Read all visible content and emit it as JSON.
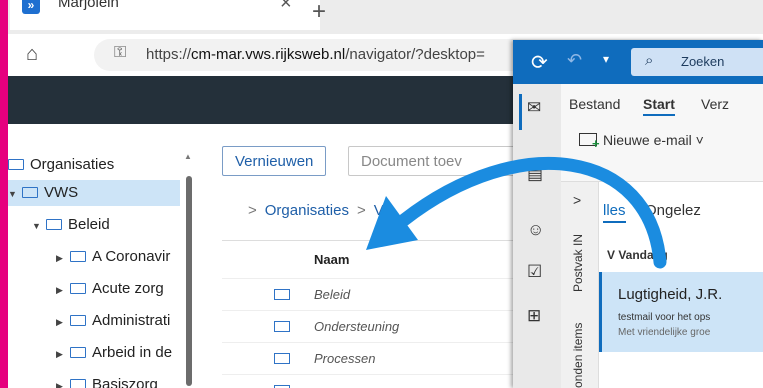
{
  "browser": {
    "tab_title": "Marjolein",
    "tab_icon": "»",
    "tab_close": "×",
    "new_tab": "+",
    "home_icon": "⌂",
    "lock_icon": "⚿",
    "url_prefix": "https://",
    "url_host": "cm-mar.vws.rijksweb.nl",
    "url_path": "/navigator/?desktop="
  },
  "tree": {
    "items": [
      {
        "label": "Organisaties",
        "caret": ""
      },
      {
        "label": "VWS",
        "caret": "▼"
      },
      {
        "label": "Beleid",
        "caret": "▼"
      },
      {
        "label": "A Coronavir",
        "caret": "▶"
      },
      {
        "label": "Acute zorg",
        "caret": "▶"
      },
      {
        "label": "Administrati",
        "caret": "▶"
      },
      {
        "label": "Arbeid in de",
        "caret": "▶"
      },
      {
        "label": "Basiszorg",
        "caret": "▶"
      }
    ]
  },
  "main": {
    "refresh_label": "Vernieuwen",
    "doc_label": "Document toev",
    "breadcrumb_root": "Organisaties",
    "breadcrumb_next": "V",
    "breadcrumb_sep": ">",
    "column_name": "Naam",
    "rows": [
      "Beleid",
      "Ondersteuning",
      "Processen"
    ]
  },
  "outlook": {
    "search_label": "Zoeken",
    "search_icon": "⌕",
    "sync_icon": "⟳",
    "undo_icon": "↶",
    "caret": "▾",
    "ribbon_tabs": [
      "Bestand",
      "Start",
      "Verz"
    ],
    "new_mail_label": "Nieuwe e-mail",
    "new_mail_caret": "˅",
    "folder_chevron": ">",
    "folder_labels": [
      "Postvak IN",
      "onden items"
    ],
    "list_tabs": [
      "lles",
      "Ongelez"
    ],
    "group_label": "V  Vandaag",
    "mail": {
      "from": "Lugtigheid, J.R.",
      "subject": "testmail voor het ops",
      "preview": "Met vriendelijke groe"
    }
  },
  "colors": {
    "frame": "#e6007e",
    "outlook_blue": "#0f6cbd",
    "arrow": "#1b8ce0"
  }
}
